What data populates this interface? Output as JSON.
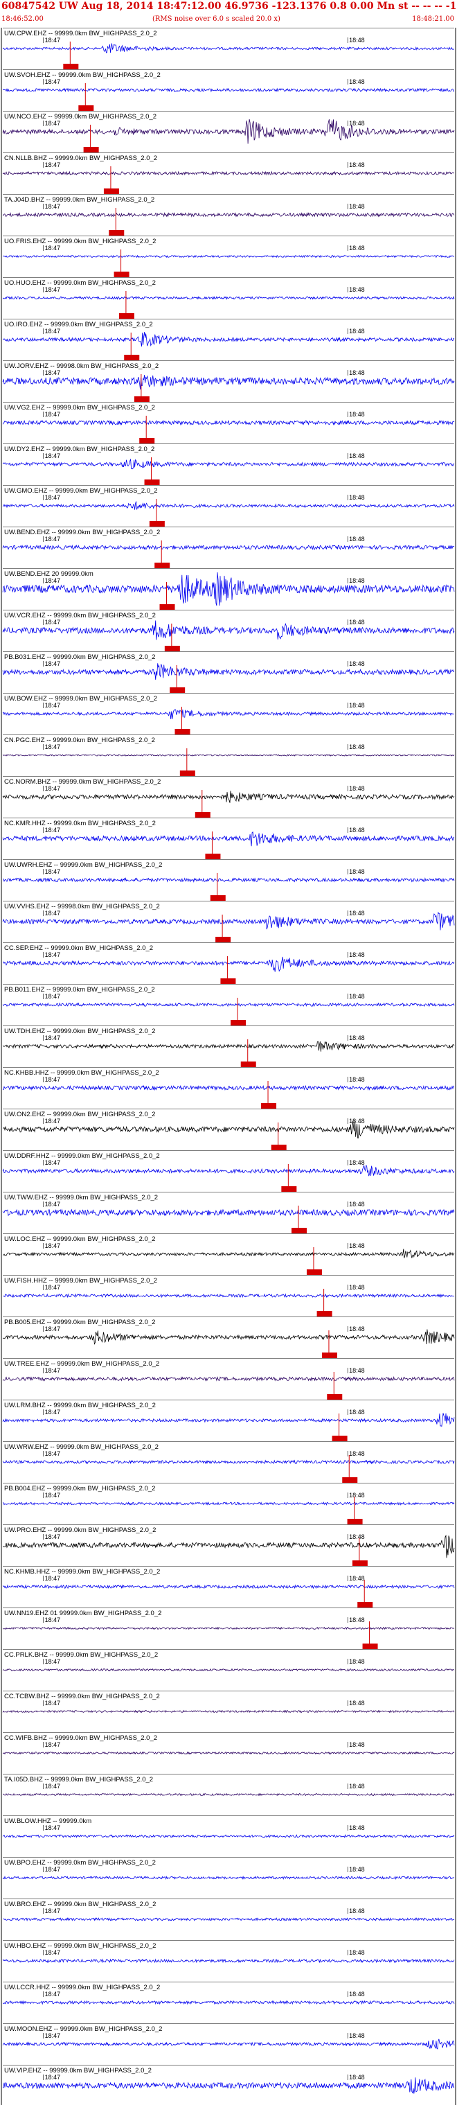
{
  "header": {
    "title": "60847542 UW Aug 18, 2014 18:47:12.00   46.9736 -123.1376  0.8 0.00 Mn st -- -- --  -1",
    "start_time": "18:46:52.00",
    "rms_note": "(RMS noise over 6.0 s scaled 20.0 x)",
    "end_time": "18:48:21.00"
  },
  "colors": {
    "accent": "#d40000",
    "blue": "#0000ee",
    "black": "#000000",
    "purple": "#2a0060"
  },
  "chart_data": {
    "type": "line",
    "title": "60847542 UW Aug 18, 2014 18:47:12.00",
    "x_unit": "seconds",
    "time_range": [
      "18:46:52.00",
      "18:48:21.00"
    ],
    "tick_labels": [
      "18:47",
      "18:48"
    ],
    "tick_seconds": [
      8,
      68
    ],
    "duration_seconds": 89,
    "series": [
      {
        "name": "UW.CPW.EHZ -- 99999.0km BW_HIGHPASS_2.0_2",
        "color": "#0000ee",
        "amp": 0.25,
        "bursts": [
          [
            20,
            1.2
          ]
        ]
      },
      {
        "name": "UW.SVOH.EHZ -- 99999.0km BW_HIGHPASS_2.0_2",
        "color": "#0000ee",
        "amp": 0.3,
        "bursts": []
      },
      {
        "name": "UW.NCO.EHZ -- 99999.0km BW_HIGHPASS_2.0_2",
        "color": "#2a0060",
        "amp": 0.45,
        "bursts": [
          [
            22,
            0.5
          ],
          [
            48,
            2.5
          ],
          [
            64,
            2.8
          ]
        ]
      },
      {
        "name": "CN.NLLB.BHZ -- 99999.0km BW_HIGHPASS_2.0_2",
        "color": "#2a0060",
        "amp": 0.3,
        "bursts": []
      },
      {
        "name": "TA.J04D.BHZ -- 99999.0km BW_HIGHPASS_2.0_2",
        "color": "#2a0060",
        "amp": 0.35,
        "bursts": []
      },
      {
        "name": "UO.FRIS.EHZ -- 99999.0km BW_HIGHPASS_2.0_2",
        "color": "#0000ee",
        "amp": 0.2,
        "bursts": []
      },
      {
        "name": "UO.HUO.EHZ -- 99999.0km BW_HIGHPASS_2.0_2",
        "color": "#0000ee",
        "amp": 0.25,
        "bursts": []
      },
      {
        "name": "UO.IRO.EHZ -- 99999.0km BW_HIGHPASS_2.0_2",
        "color": "#0000ee",
        "amp": 0.35,
        "bursts": [
          [
            27,
            1.6
          ]
        ]
      },
      {
        "name": "UW.JORV.EHZ -- 99998.0km BW_HIGHPASS_2.0_2",
        "color": "#0000ee",
        "amp": 0.7,
        "bursts": [
          [
            27,
            1.2
          ]
        ]
      },
      {
        "name": "UW.VG2.EHZ -- 99999.0km BW_HIGHPASS_2.0_2",
        "color": "#0000ee",
        "amp": 0.4,
        "bursts": []
      },
      {
        "name": "UW.DY2.EHZ -- 99999.0km BW_HIGHPASS_2.0_2",
        "color": "#0000ee",
        "amp": 0.35,
        "bursts": [
          [
            24,
            1.0
          ]
        ]
      },
      {
        "name": "UW.GMO.EHZ -- 99999.0km BW_HIGHPASS_2.0_2",
        "color": "#0000ee",
        "amp": 0.3,
        "bursts": [
          [
            25,
            0.8
          ]
        ]
      },
      {
        "name": "UW.BEND.EHZ -- 99999.0km BW_HIGHPASS_2.0_2",
        "color": "#0000ee",
        "amp": 0.4,
        "bursts": []
      },
      {
        "name": "UW.BEND.EHZ 20 99999.0km",
        "color": "#0000ee",
        "amp": 0.8,
        "bursts": [
          [
            35,
            3.2
          ],
          [
            42,
            2.8
          ]
        ]
      },
      {
        "name": "UW.VCR.EHZ -- 99999.0km BW_HIGHPASS_2.0_2",
        "color": "#0000ee",
        "amp": 0.6,
        "bursts": [
          [
            30,
            1.8
          ],
          [
            54,
            1.4
          ]
        ]
      },
      {
        "name": "PB.B031.EHZ -- 99999.0km BW_HIGHPASS_2.0_2",
        "color": "#0000ee",
        "amp": 0.5,
        "bursts": [
          [
            30,
            1.6
          ]
        ]
      },
      {
        "name": "UW.BOW.EHZ -- 99999.0km BW_HIGHPASS_2.0_2",
        "color": "#0000ee",
        "amp": 0.3,
        "bursts": [
          [
            33,
            1.0
          ]
        ]
      },
      {
        "name": "CN.PGC.EHZ -- 99999.0km BW_HIGHPASS_2.0_2",
        "color": "#2a0060",
        "amp": 0.15,
        "bursts": []
      },
      {
        "name": "CC.NORM.BHZ -- 99999.0km BW_HIGHPASS_2.0_2",
        "color": "#000000",
        "amp": 0.45,
        "bursts": [
          [
            44,
            1.0
          ]
        ]
      },
      {
        "name": "NC.KMR.HHZ -- 99999.0km BW_HIGHPASS_2.0_2",
        "color": "#0000ee",
        "amp": 0.5,
        "bursts": [
          [
            49,
            1.5
          ]
        ]
      },
      {
        "name": "UW.UWRH.EHZ -- 99999.0km BW_HIGHPASS_2.0_2",
        "color": "#0000ee",
        "amp": 0.35,
        "bursts": []
      },
      {
        "name": "UW.VVHS.EHZ -- 99998.0km BW_HIGHPASS_2.0_2",
        "color": "#0000ee",
        "amp": 0.45,
        "bursts": [
          [
            52,
            1.6
          ],
          [
            85,
            2.0
          ]
        ]
      },
      {
        "name": "CC.SEP.EHZ -- 99999.0km BW_HIGHPASS_2.0_2",
        "color": "#0000ee",
        "amp": 0.4,
        "bursts": [
          [
            53,
            1.8
          ]
        ]
      },
      {
        "name": "PB.B011.EHZ -- 99999.0km BW_HIGHPASS_2.0_2",
        "color": "#0000ee",
        "amp": 0.3,
        "bursts": []
      },
      {
        "name": "UW.TDH.EHZ -- 99999.0km BW_HIGHPASS_2.0_2",
        "color": "#000000",
        "amp": 0.35,
        "bursts": [
          [
            62,
            1.0
          ]
        ]
      },
      {
        "name": "NC.KHBB.HHZ -- 99999.0km BW_HIGHPASS_2.0_2",
        "color": "#0000ee",
        "amp": 0.4,
        "bursts": []
      },
      {
        "name": "UW.ON2.EHZ -- 99999.0km BW_HIGHPASS_2.0_2",
        "color": "#000000",
        "amp": 0.55,
        "bursts": [
          [
            69,
            1.8
          ]
        ]
      },
      {
        "name": "UW.DDRF.HHZ -- 99999.0km BW_HIGHPASS_2.0_2",
        "color": "#0000ee",
        "amp": 0.4,
        "bursts": [
          [
            71,
            1.0
          ]
        ]
      },
      {
        "name": "UW.TWW.EHZ -- 99999.0km BW_HIGHPASS_2.0_2",
        "color": "#0000ee",
        "amp": 0.6,
        "bursts": []
      },
      {
        "name": "UW.LOC.EHZ -- 99999.0km BW_HIGHPASS_2.0_2",
        "color": "#000000",
        "amp": 0.3,
        "bursts": [
          [
            79,
            0.8
          ]
        ]
      },
      {
        "name": "UW.FISH.HHZ -- 99999.0km BW_HIGHPASS_2.0_2",
        "color": "#0000ee",
        "amp": 0.3,
        "bursts": []
      },
      {
        "name": "PB.B005.EHZ -- 99999.0km BW_HIGHPASS_2.0_2",
        "color": "#000000",
        "amp": 0.4,
        "bursts": [
          [
            18,
            1.2
          ],
          [
            83,
            1.5
          ]
        ]
      },
      {
        "name": "UW.TREE.EHZ -- 99999.0km BW_HIGHPASS_2.0_2",
        "color": "#2a0060",
        "amp": 0.35,
        "bursts": []
      },
      {
        "name": "UW.LRM.BHZ -- 99999.0km BW_HIGHPASS_2.0_2",
        "color": "#0000ee",
        "amp": 0.3,
        "bursts": [
          [
            86,
            1.8
          ]
        ]
      },
      {
        "name": "UW.WRW.EHZ -- 99999.0km BW_HIGHPASS_2.0_2",
        "color": "#0000ee",
        "amp": 0.3,
        "bursts": []
      },
      {
        "name": "PB.B004.EHZ -- 99999.0km BW_HIGHPASS_2.0_2",
        "color": "#0000ee",
        "amp": 0.25,
        "bursts": []
      },
      {
        "name": "UW.PRO.EHZ -- 99999.0km BW_HIGHPASS_2.0_2",
        "color": "#000000",
        "amp": 0.5,
        "bursts": [
          [
            87,
            2.5
          ]
        ]
      },
      {
        "name": "NC.KHMB.HHZ -- 99999.0km BW_HIGHPASS_2.0_2",
        "color": "#0000ee",
        "amp": 0.3,
        "bursts": []
      },
      {
        "name": "UW.NN19.EHZ 01 99999.0km BW_HIGHPASS_2.0_2",
        "color": "#2a0060",
        "amp": 0.2,
        "bursts": []
      },
      {
        "name": "CC.PRLK.BHZ -- 99999.0km BW_HIGHPASS_2.0_2",
        "color": "#2a0060",
        "amp": 0.2,
        "bursts": []
      },
      {
        "name": "CC.TCBW.BHZ -- 99999.0km BW_HIGHPASS_2.0_2",
        "color": "#2a0060",
        "amp": 0.2,
        "bursts": []
      },
      {
        "name": "CC.WIFB.BHZ -- 99999.0km BW_HIGHPASS_2.0_2",
        "color": "#2a0060",
        "amp": 0.2,
        "bursts": []
      },
      {
        "name": "TA.I05D.BHZ -- 99999.0km BW_HIGHPASS_2.0_2",
        "color": "#2a0060",
        "amp": 0.2,
        "bursts": []
      },
      {
        "name": "UW.BLOW.HHZ -- 99999.0km",
        "color": "#0000ee",
        "amp": 0.25,
        "bursts": []
      },
      {
        "name": "UW.BPO.EHZ -- 99999.0km BW_HIGHPASS_2.0_2",
        "color": "#0000ee",
        "amp": 0.25,
        "bursts": []
      },
      {
        "name": "UW.BRO.EHZ -- 99999.0km BW_HIGHPASS_2.0_2",
        "color": "#0000ee",
        "amp": 0.25,
        "bursts": []
      },
      {
        "name": "UW.HBO.EHZ -- 99999.0km BW_HIGHPASS_2.0_2",
        "color": "#0000ee",
        "amp": 0.3,
        "bursts": []
      },
      {
        "name": "UW.LCCR.HHZ -- 99999.0km BW_HIGHPASS_2.0_2",
        "color": "#0000ee",
        "amp": 0.3,
        "bursts": []
      },
      {
        "name": "UW.MOON.EHZ -- 99999.0km BW_HIGHPASS_2.0_2",
        "color": "#0000ee",
        "amp": 0.3,
        "bursts": [
          [
            84,
            1.2
          ]
        ]
      },
      {
        "name": "UW.VIP.EHZ -- 99999.0km BW_HIGHPASS_2.0_2",
        "color": "#0000ee",
        "amp": 0.6,
        "bursts": [
          [
            80,
            1.6
          ]
        ]
      }
    ],
    "p_picks_seconds": [
      1,
      4,
      5,
      9,
      10,
      11,
      12,
      13,
      15,
      16,
      17,
      18,
      19,
      20,
      21,
      22,
      23,
      24,
      27,
      29,
      30,
      31,
      32,
      34,
      36,
      40,
      42,
      44,
      46,
      49,
      51,
      52,
      53,
      54,
      56,
      57,
      58,
      59,
      60
    ]
  }
}
